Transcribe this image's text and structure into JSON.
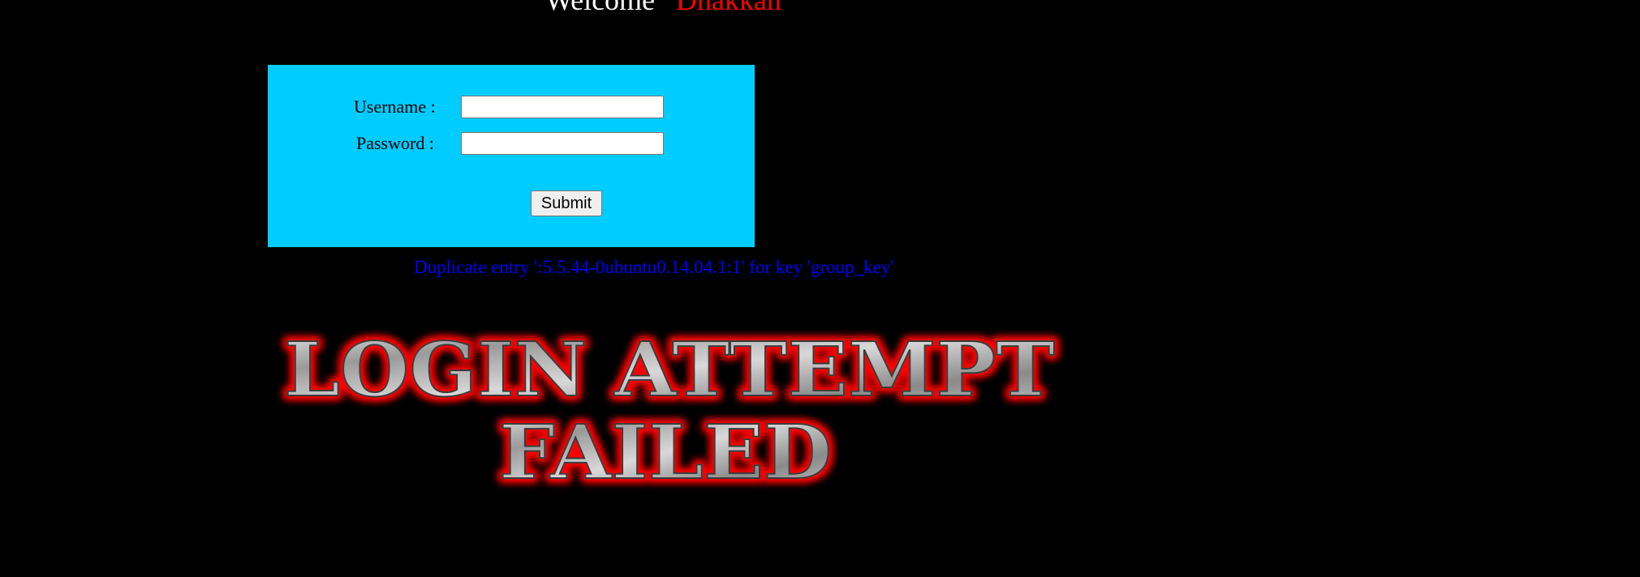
{
  "header": {
    "welcome_word": "Welcome",
    "user_name": "Dhakkan"
  },
  "form": {
    "username_label": "Username :",
    "password_label": "Password :",
    "username_value": "",
    "password_value": "",
    "submit_label": "Submit"
  },
  "error": {
    "message": "Duplicate entry ':5.5.44-0ubuntu0.14.04.1:1' for key 'group_key'"
  },
  "banner": {
    "line1": "LOGIN ATTEMPT",
    "line2": "FAILED"
  },
  "colors": {
    "background": "#000000",
    "form_bg": "#00ccff",
    "welcome_text": "#ffffff",
    "user_name": "#ff0000",
    "error_text": "#0000ff",
    "banner_glow": "#ff0000"
  }
}
